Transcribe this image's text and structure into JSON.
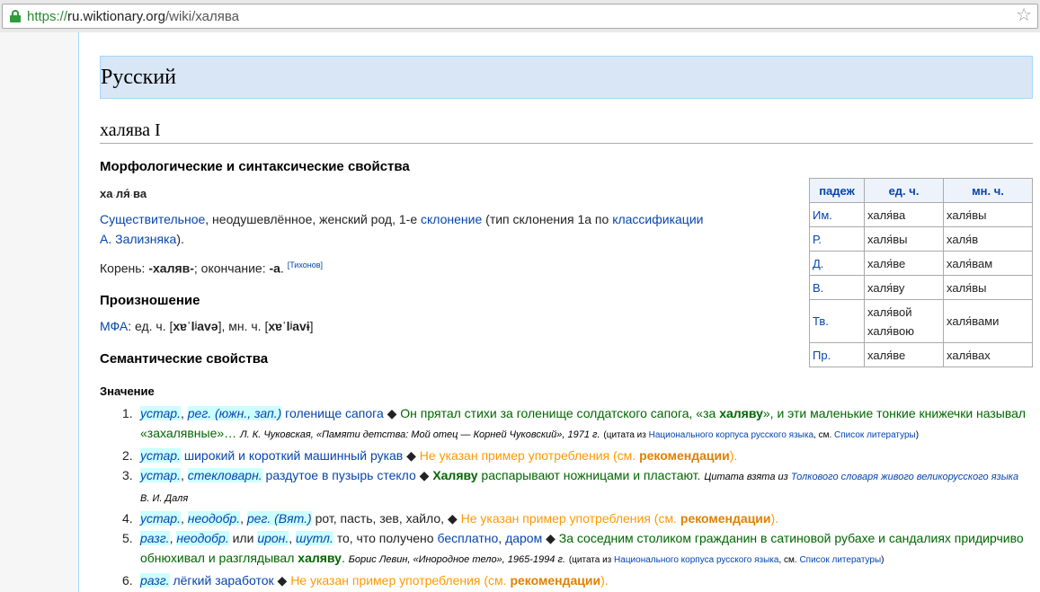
{
  "browser": {
    "url_scheme": "https://",
    "url_host": "ru.wiktionary.org",
    "url_path": "/wiki/халява"
  },
  "language_heading": "Русский",
  "word_heading": "халява I",
  "morph": {
    "heading": "Морфологические и синтаксические свойства",
    "syllables": [
      "ха",
      "ля́",
      "ва"
    ],
    "pos_link": "Существительное",
    "pos_rest": ", неодушевлённое, женский род, 1-е ",
    "decl_link": "склонение",
    "decl_rest": " (тип склонения 1a по ",
    "class_link": "классификации",
    "zaliz_link": "А. Зализняка",
    "zaliz_rest": ").",
    "root_prefix": "Корень: ",
    "root_value": "-халяв-",
    "ending_prefix": "; окончание: ",
    "ending_value": "-а",
    "ref": "[Тихонов]"
  },
  "pron": {
    "heading": "Произношение",
    "ipa_link": "МФА",
    "ipa_sg_label": ": ед. ч. [",
    "ipa_sg": "xɐˈlʲavə",
    "ipa_pl_label": "], мн. ч. [",
    "ipa_pl": "xɐˈlʲavɨ",
    "close": "]"
  },
  "sem": {
    "heading": "Семантические свойства",
    "meaning_heading": "Значение"
  },
  "table": {
    "headers": [
      "падеж",
      "ед. ч.",
      "мн. ч."
    ],
    "rows": [
      {
        "case": "Им.",
        "sg": "халя́ва",
        "pl": "халя́вы"
      },
      {
        "case": "Р.",
        "sg": "халя́вы",
        "pl": "халя́в"
      },
      {
        "case": "Д.",
        "sg": "халя́ве",
        "pl": "халя́вам"
      },
      {
        "case": "В.",
        "sg": "халя́ву",
        "pl": "халя́вы"
      },
      {
        "case": "Тв.",
        "sg": "халя́вой",
        "sg2": "халя́вою",
        "pl": "халя́вами"
      },
      {
        "case": "Пр.",
        "sg": "халя́ве",
        "pl": "халя́вах"
      }
    ]
  },
  "meanings": [
    {
      "num": "1.",
      "lbl1": "устар.",
      "lbl2": "рег. (южн., зап.)",
      "def": "голенище сапога",
      "ex_pre": "Он прятал стихи за голенище солдатского сапога, «за ",
      "ex_bold": "халяву",
      "ex_post": "», и эти маленькие тонкие книжечки называл «захалявные»…",
      "src": "Л. К. Чуковская, «Памяти детства: Мой отец — Корней Чуковский», 1971 г.",
      "src_note_pre": "(цитата из ",
      "src_note_link": "Национального корпуса русского языка",
      "src_note_mid": ", см. ",
      "src_note_link2": "Список литературы",
      "src_note_post": ")"
    },
    {
      "num": "2.",
      "lbl1": "устар.",
      "def": "широкий и короткий машинный рукав",
      "noex_pre": "Не указан пример употребления (см. ",
      "noex_bold": "рекомендации",
      "noex_post": ")."
    },
    {
      "num": "3.",
      "lbl1": "устар.",
      "lbl2": "стекловарн.",
      "def": "раздутое в пузырь стекло",
      "ex_bold": "Халяву",
      "ex_post": " распарывают ножницами и пластают.",
      "src_pre": "Цитата взята из ",
      "src_link": "Толкового словаря живого великорусского языка",
      "src_line2": "В. И. Даля"
    },
    {
      "num": "4.",
      "lbl1": "устар.",
      "lbl2": "неодобр.",
      "lbl3": "рег. (Вят.)",
      "def": "рот, пасть, зев, хайло,",
      "noex_pre": "Не указан пример употребления (см. ",
      "noex_bold": "рекомендации",
      "noex_post": ")."
    },
    {
      "num": "5.",
      "lbl1": "разг.",
      "lbl2": "неодобр.",
      "or": "или",
      "lbl3": "ирон.",
      "lbl4": "шутл.",
      "def_pre": "то, что получено ",
      "def_link1": "бесплатно",
      "def_mid": ", ",
      "def_link2": "даром",
      "ex_pre": "За соседним столиком гражданин в сатиновой рубахе и сандалиях придирчиво обнюхивал и разглядывал ",
      "ex_bold": "халяву",
      "ex_post": ".",
      "src": "Борис Левин, «Инородное тело», 1965-1994 г.",
      "src_note_pre": "(цитата из ",
      "src_note_link": "Национального корпуса русского языка",
      "src_note_mid": ", см. ",
      "src_note_link2": "Список литературы",
      "src_note_post": ")"
    },
    {
      "num": "6.",
      "lbl1": "разг.",
      "def_link1": "лёгкий",
      "def_link2": "заработок",
      "noex_pre": "Не указан пример употребления (см. ",
      "noex_bold": "рекомендации",
      "noex_post": ")."
    }
  ]
}
